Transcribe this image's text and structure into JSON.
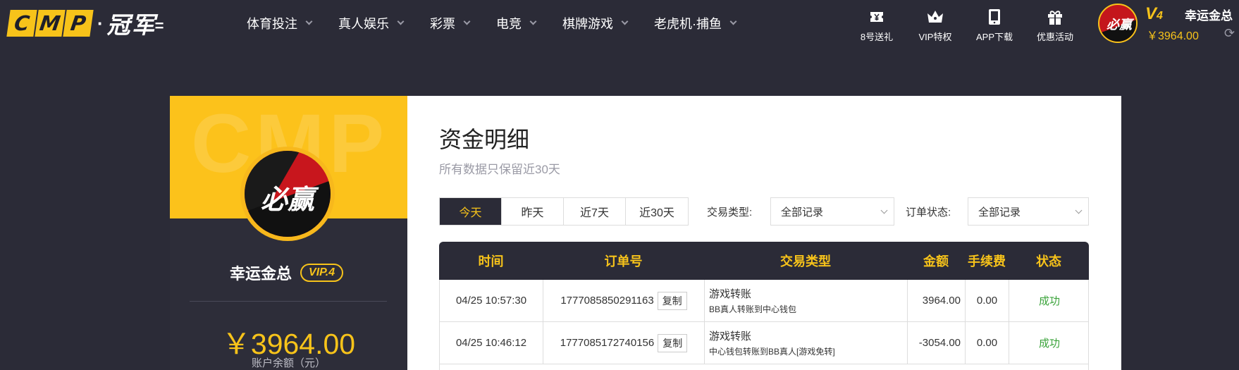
{
  "header": {
    "logo_letters": [
      "C",
      "M",
      "P"
    ],
    "logo_text": "冠军",
    "nav": [
      {
        "label": "体育投注"
      },
      {
        "label": "真人娱乐"
      },
      {
        "label": "彩票"
      },
      {
        "label": "电竞"
      },
      {
        "label": "棋牌游戏"
      },
      {
        "label": "老虎机·捕鱼"
      }
    ],
    "quick_links": [
      {
        "label": "8号送礼",
        "icon": "ticket-icon"
      },
      {
        "label": "VIP特权",
        "icon": "crown-icon"
      },
      {
        "label": "APP下载",
        "icon": "phone-icon"
      },
      {
        "label": "优惠活动",
        "icon": "gift-icon"
      }
    ],
    "user": {
      "avatar_text": "必赢",
      "vip_level": "V",
      "vip_num": "4",
      "username": "幸运金总",
      "balance": "￥3964.00"
    }
  },
  "profile": {
    "watermark": "CMP",
    "avatar_text": "必赢",
    "name": "幸运金总",
    "vip_badge": "VIP.4",
    "balance": "￥3964.00",
    "balance_label": "账户余额（元）"
  },
  "main": {
    "title": "资金明细",
    "subtitle": "所有数据只保留近30天",
    "tabs": [
      {
        "label": "今天",
        "active": true
      },
      {
        "label": "昨天",
        "active": false
      },
      {
        "label": "近7天",
        "active": false
      },
      {
        "label": "近30天",
        "active": false
      }
    ],
    "filters": {
      "trade_type_label": "交易类型:",
      "trade_type_value": "全部记录",
      "order_status_label": "订单状态:",
      "order_status_value": "全部记录"
    },
    "table": {
      "columns": [
        "时间",
        "订单号",
        "交易类型",
        "金额",
        "手续费",
        "状态"
      ],
      "copy_label": "复制",
      "rows": [
        {
          "time": "04/25 10:57:30",
          "order_no": "1777085850291163",
          "type_main": "游戏转账",
          "type_sub": "BB真人转账到中心钱包",
          "amount": "3964.00",
          "fee": "0.00",
          "status": "成功"
        },
        {
          "time": "04/25 10:46:12",
          "order_no": "1777085172740156",
          "type_main": "游戏转账",
          "type_sub": "中心钱包转账到BB真人[游戏免转]",
          "amount": "-3054.00",
          "fee": "0.00",
          "status": "成功"
        }
      ]
    }
  },
  "colors": {
    "background": "#2b2b37",
    "accent": "#f7c31a",
    "success": "#3aa33a"
  }
}
